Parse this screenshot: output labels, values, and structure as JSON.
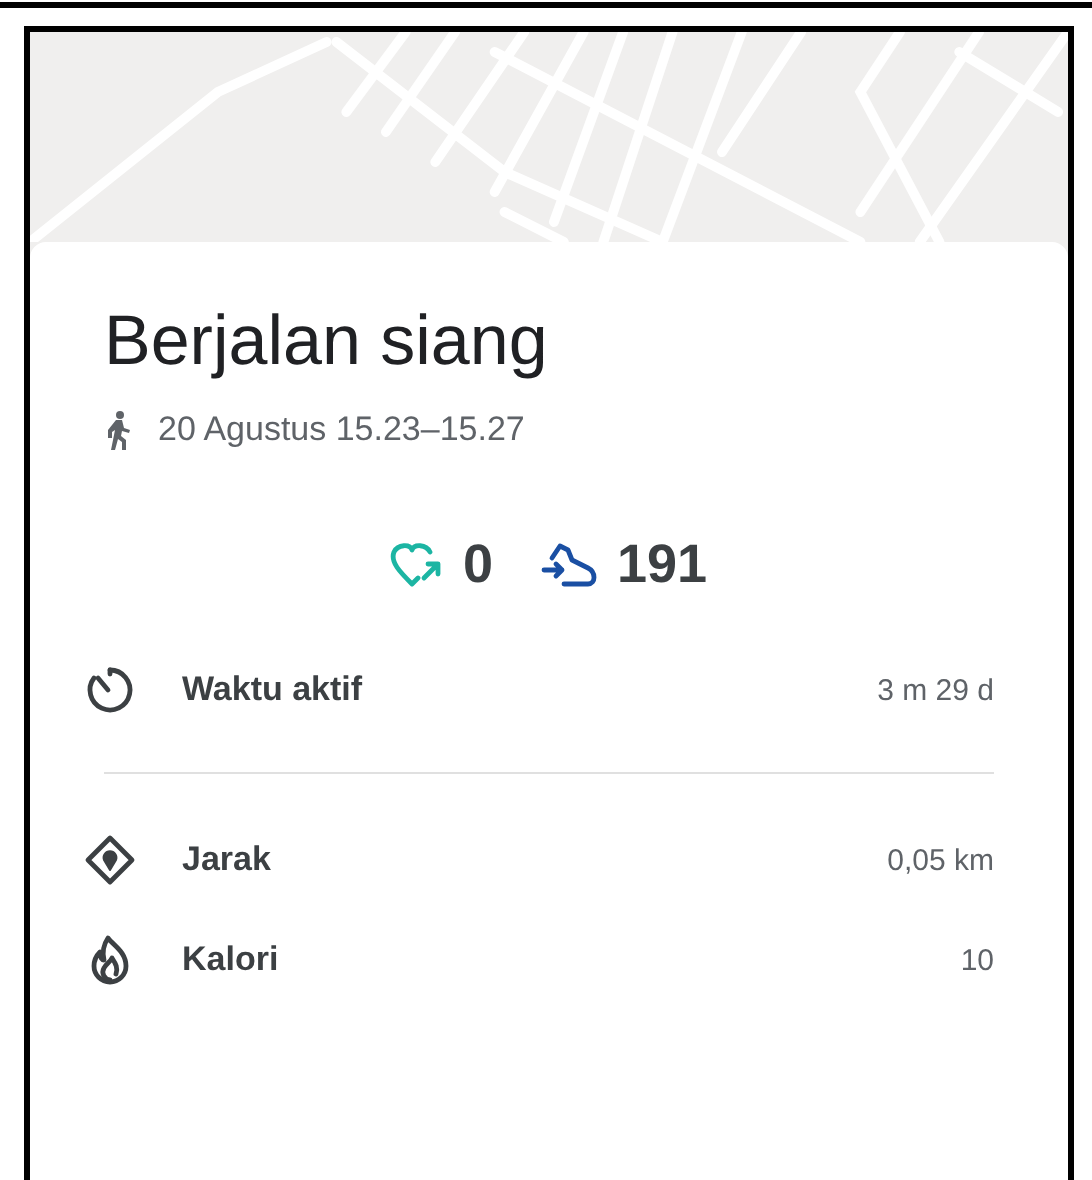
{
  "activity": {
    "title": "Berjalan siang",
    "time_range": "20 Agustus 15.23–15.27"
  },
  "stats": [
    {
      "kind": "heart",
      "value": "0"
    },
    {
      "kind": "steps",
      "value": "191"
    }
  ],
  "sections": [
    {
      "metrics": [
        {
          "kind": "timer",
          "label": "Waktu aktif",
          "value": "3 m 29 d"
        }
      ]
    },
    {
      "metrics": [
        {
          "kind": "distance",
          "label": "Jarak",
          "value": "0,05 km"
        },
        {
          "kind": "calories",
          "label": "Kalori",
          "value": "10"
        }
      ]
    }
  ]
}
